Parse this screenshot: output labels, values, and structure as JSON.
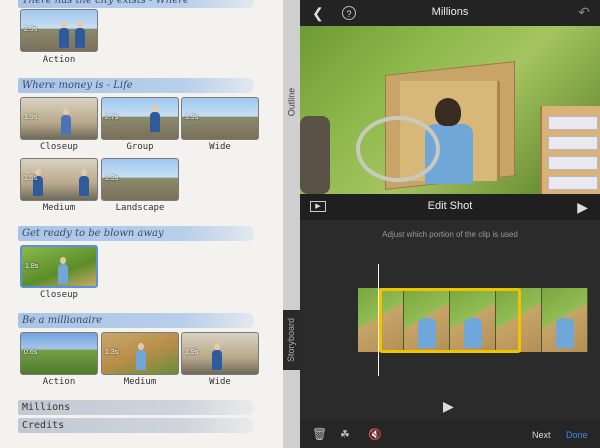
{
  "storyboard": {
    "sections": [
      {
        "title": "There has the city exists - Where",
        "shots": [
          {
            "label": "Action",
            "duration": "2.9s"
          }
        ]
      },
      {
        "title": "Where money is - Life",
        "shots": [
          {
            "label": "Closeup",
            "duration": "1.9s"
          },
          {
            "label": "Group",
            "duration": "2.7s"
          },
          {
            "label": "Wide",
            "duration": "1.9s"
          },
          {
            "label": "Medium",
            "duration": "1.5s"
          },
          {
            "label": "Landscape",
            "duration": "1.3s"
          }
        ]
      },
      {
        "title": "Get ready to be blown away",
        "shots": [
          {
            "label": "Closeup",
            "duration": "1.8s"
          }
        ]
      },
      {
        "title": "Be a millionaire",
        "shots": [
          {
            "label": "Action",
            "duration": "0.6s"
          },
          {
            "label": "Medium",
            "duration": "1.3s"
          },
          {
            "label": "Wide",
            "duration": "1.9s"
          }
        ]
      }
    ],
    "extra_sections": [
      "Millions",
      "Credits"
    ]
  },
  "side_tabs": {
    "outline": "Outline",
    "storyboard": "Storyboard"
  },
  "editor": {
    "title": "Millions",
    "edit_label": "Edit Shot",
    "help_text": "Adjust which portion of the clip is used",
    "next": "Next",
    "done": "Done",
    "accent_color": "#f1c400",
    "link_color": "#3a8ee6"
  }
}
